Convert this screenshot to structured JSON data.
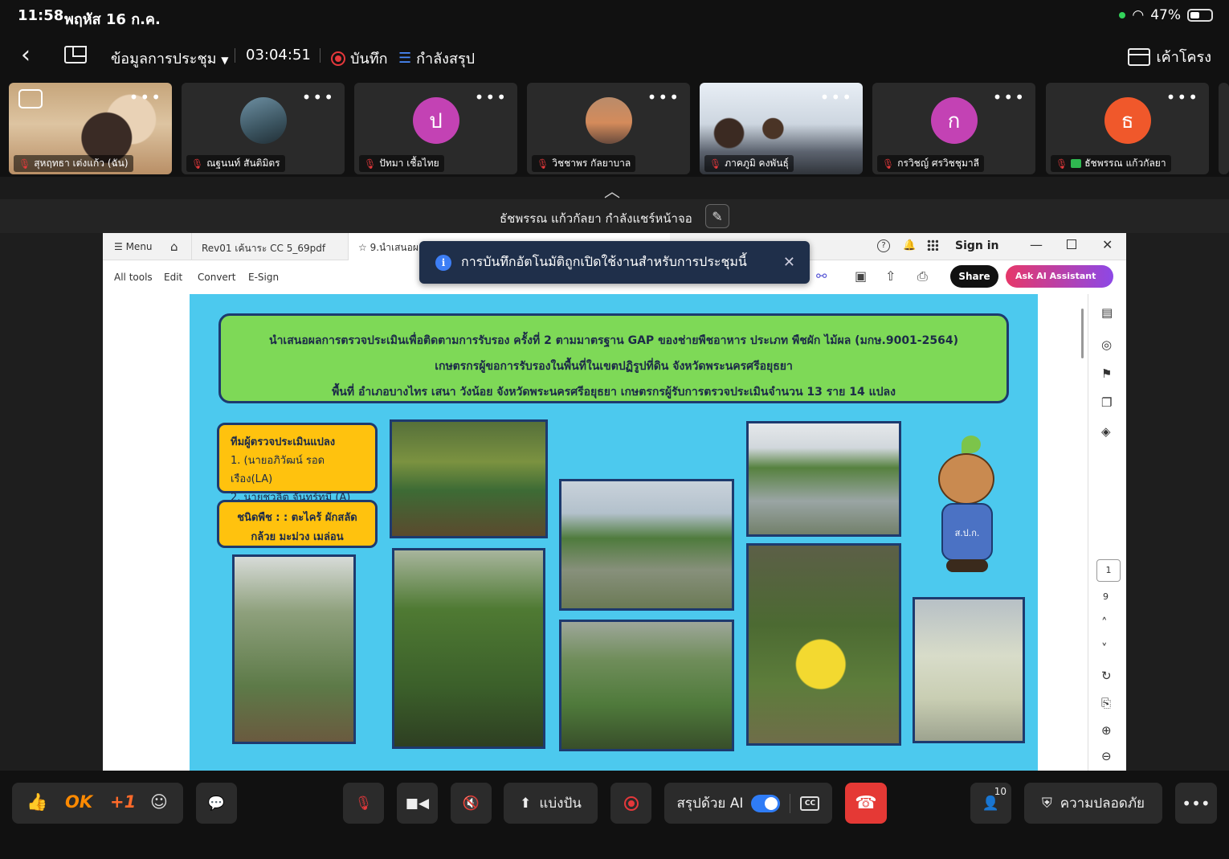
{
  "status_bar": {
    "time": "11:58",
    "date": "พฤหัส 16 ก.ค.",
    "battery": "47%",
    "battery_level": 0.47
  },
  "header": {
    "meeting_info": "ข้อมูลการประชุม",
    "timer": "03:04:51",
    "record": "บันทึก",
    "summarizing": "กำลังสรุป",
    "layout": "เค้าโครง"
  },
  "participants": [
    {
      "name": "สุหฤทธา เต่งแก้ว (ฉัน)",
      "type": "video",
      "muted": true
    },
    {
      "name": "ณฐนนท์ สันติมิตร",
      "type": "photo",
      "muted": true
    },
    {
      "name": "ปัทมา เชื้อไทย",
      "type": "initial",
      "initial": "ป",
      "color": "#c342b4",
      "muted": true
    },
    {
      "name": "วิชชาพร กัลยาบาล",
      "type": "photo",
      "muted": true
    },
    {
      "name": "ภาคภูมิ คงพันธุ์",
      "type": "video",
      "muted": true
    },
    {
      "name": "กรวิชญ์ ศรวิชชุมาลี",
      "type": "initial",
      "initial": "ก",
      "color": "#c342b4",
      "muted": true
    },
    {
      "name": "ธัชพรรณ แก้วกัลยา",
      "type": "initial",
      "initial": "ธ",
      "color": "#f0582b",
      "muted": true,
      "sharing": true
    }
  ],
  "share_banner": {
    "text": "ธัชพรรณ แก้วกัลยา กำลังแชร์หน้าจอ"
  },
  "pdf_viewer": {
    "menu": "Menu",
    "tab1": "Rev01 เค้นาระ CC 5_69pdf",
    "tab2": "9.นำเสนอผ...",
    "sign_in": "Sign in",
    "tools": [
      "All tools",
      "Edit",
      "Convert",
      "E-Sign"
    ],
    "share": "Share",
    "ai": "Ask AI Assistant",
    "page_current": "1",
    "page_total": "9"
  },
  "toast": {
    "text": "การบันทึกอัตโนมัติถูกเปิดใช้งานสำหรับการประชุมนี้"
  },
  "slide": {
    "title_lines": [
      "นำเสนอผลการตรวจประเมินเพื่อติดตามการรับรอง ครั้งที่ 2 ตามมาตรฐาน GAP ของช่ายพืชอาหาร ประเภท พืชผัก ไม้ผล (มกษ.9001-2564)",
      "เกษตรกรผู้ขอการรับรองในพื้นที่ในเขตปฏิรูปที่ดิน จังหวัดพระนครศรีอยุธยา",
      "พื้นที่ อำเภอบางไทร เสนา วังน้อย จังหวัดพระนครศรีอยุธยา เกษตรกรผู้รับการตรวจประเมินจำนวน 13 ราย 14 แปลง"
    ],
    "team_title": "ทีมผู้ตรวจประเมินแปลง",
    "team_members": [
      "1. (นายอภิวัฒน์ รอดเรือง(LA)",
      "2. นายชวลิต จันทร์ทมี (A)"
    ],
    "crops_line1": "ชนิดพืช : : ตะไคร้ ผักสลัด",
    "crops_line2": "กล้วย มะม่วง เมล่อน",
    "mascot_label": "ส.ป.ก."
  },
  "controls": {
    "ok": "OK",
    "plus_one": "+1",
    "share_screen": "แบ่งปัน",
    "ai_summary": "สรุปด้วย AI",
    "ai_summary_on": true,
    "cc": "CC",
    "participants_count": "10",
    "security": "ความปลอดภัย"
  }
}
